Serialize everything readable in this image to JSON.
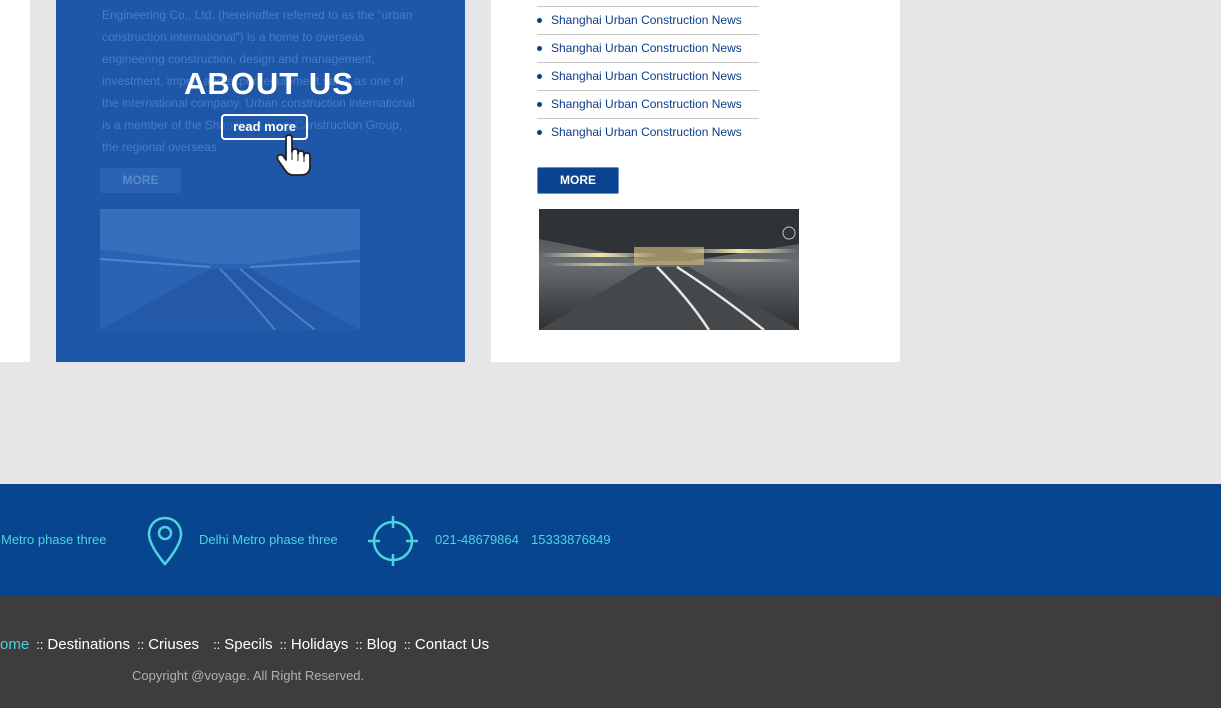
{
  "about": {
    "title": "ABOUT US",
    "read_more_label": "read more",
    "more_label": "MORE",
    "description": "Engineering Co., Ltd. (hereinafter referred to as the \"urban construction international\") is a home to overseas engineering construction, design and management, investment, import and export equipment sales as one of the international company. Urban construction international is a member of the Shanghai Urban Construction Group, the regional overseas"
  },
  "news": {
    "items": [
      "Shanghai Urban Construction News",
      "Shanghai Urban Construction News",
      "Shanghai Urban Construction News",
      "Shanghai Urban Construction News",
      "Shanghai Urban Construction News"
    ],
    "more_label": "MORE"
  },
  "contact": {
    "address_1": "Metro phase three",
    "address_2": "Delhi Metro phase three",
    "phone_1": "021-48679864",
    "phone_2": "15333876849",
    "icons": [
      "location-pin-icon",
      "crosshair-target-icon"
    ],
    "accent_color": "#4fd1e0"
  },
  "footer": {
    "nav": [
      {
        "key": "home",
        "label": "ome"
      },
      {
        "key": "destinations",
        "label": "Destinations"
      },
      {
        "key": "criuses",
        "label": "Criuses"
      },
      {
        "key": "specils",
        "label": "Specils"
      },
      {
        "key": "holidays",
        "label": "Holidays"
      },
      {
        "key": "blog",
        "label": "Blog"
      },
      {
        "key": "contact",
        "label": "Contact Us"
      }
    ],
    "separator": "::",
    "copyright": "Copyright @voyage. All Right Reserved."
  },
  "colors": {
    "page_bg": "#e6e6e6",
    "about_blue": "#1e56a8",
    "contact_bar": "#07468f",
    "footer_bg": "#3d3d3d",
    "news_link": "#0c3d8a"
  }
}
